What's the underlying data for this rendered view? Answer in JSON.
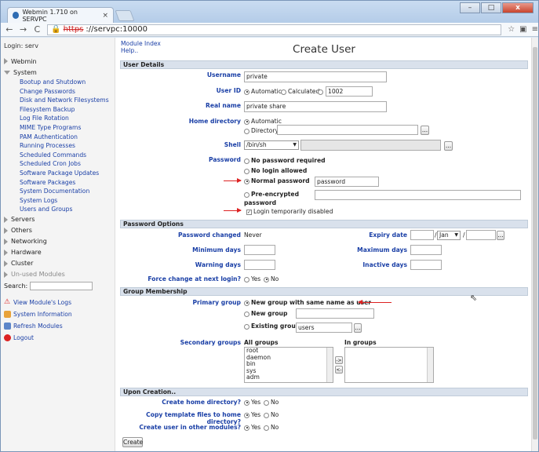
{
  "browser": {
    "tab_title": "Webmin 1.710 on SERVPC",
    "url_scheme": "https",
    "url_host": "://servpc:10000"
  },
  "sidebar": {
    "login": "Login: serv",
    "categories_top": [
      {
        "label": "Webmin",
        "open": false
      },
      {
        "label": "System",
        "open": true
      }
    ],
    "system_modules": [
      "Bootup and Shutdown",
      "Change Passwords",
      "Disk and Network Filesystems",
      "Filesystem Backup",
      "Log File Rotation",
      "MIME Type Programs",
      "PAM Authentication",
      "Running Processes",
      "Scheduled Commands",
      "Scheduled Cron Jobs",
      "Software Package Updates",
      "Software Packages",
      "System Documentation",
      "System Logs",
      "Users and Groups"
    ],
    "categories_bottom": [
      "Servers",
      "Others",
      "Networking",
      "Hardware",
      "Cluster",
      "Un-used Modules"
    ],
    "search_label": "Search:",
    "actions": [
      "View Module's Logs",
      "System Information",
      "Refresh Modules",
      "Logout"
    ]
  },
  "main": {
    "module_index": "Module Index",
    "help": "Help..",
    "title": "Create User",
    "sections": {
      "user_details": "User Details",
      "password_options": "Password Options",
      "group_membership": "Group Membership",
      "upon_creation": "Upon Creation.."
    },
    "username_label": "Username",
    "username": "private",
    "userid_label": "User ID",
    "userid_auto": "Automatic",
    "userid_calc": "Calculated",
    "userid_value": "1002",
    "realname_label": "Real name",
    "realname": "private share",
    "homedir_label": "Home directory",
    "homedir_auto": "Automatic",
    "homedir_dir": "Directory",
    "shell_label": "Shell",
    "shell": "/bin/sh",
    "password_label": "Password",
    "pw_none": "No password required",
    "pw_nologin": "No login allowed",
    "pw_normal": "Normal password",
    "pw_normal_value": "password",
    "pw_pre1": "Pre-encrypted",
    "pw_pre2": "password",
    "pw_disabled": "Login temporarily disabled",
    "pw_changed_label": "Password changed",
    "pw_changed": "Never",
    "expiry_label": "Expiry date",
    "expiry_month": "Jan",
    "min_days_label": "Minimum days",
    "max_days_label": "Maximum days",
    "warning_days_label": "Warning days",
    "inactive_days_label": "Inactive days",
    "force_change_label": "Force change at next login?",
    "yes": "Yes",
    "no": "No",
    "primary_group_label": "Primary group",
    "pg_same": "New group with same name as user",
    "pg_new": "New group",
    "pg_existing": "Existing group",
    "pg_existing_value": "users",
    "secondary_label": "Secondary groups",
    "all_groups": "All groups",
    "in_groups": "In groups",
    "groups": [
      "root",
      "daemon",
      "bin",
      "sys",
      "adm"
    ],
    "add_btn": "->",
    "remove_btn": "<-",
    "browse_btn": "...",
    "create_home_label": "Create home directory?",
    "copy_files_label": "Copy template files to home directory?",
    "create_other_label": "Create user in other modules?",
    "create_button": "Create"
  },
  "colors": {
    "link": "#1a3fa6",
    "section_bg": "#d9e1ec",
    "arrow": "#dd2222"
  }
}
